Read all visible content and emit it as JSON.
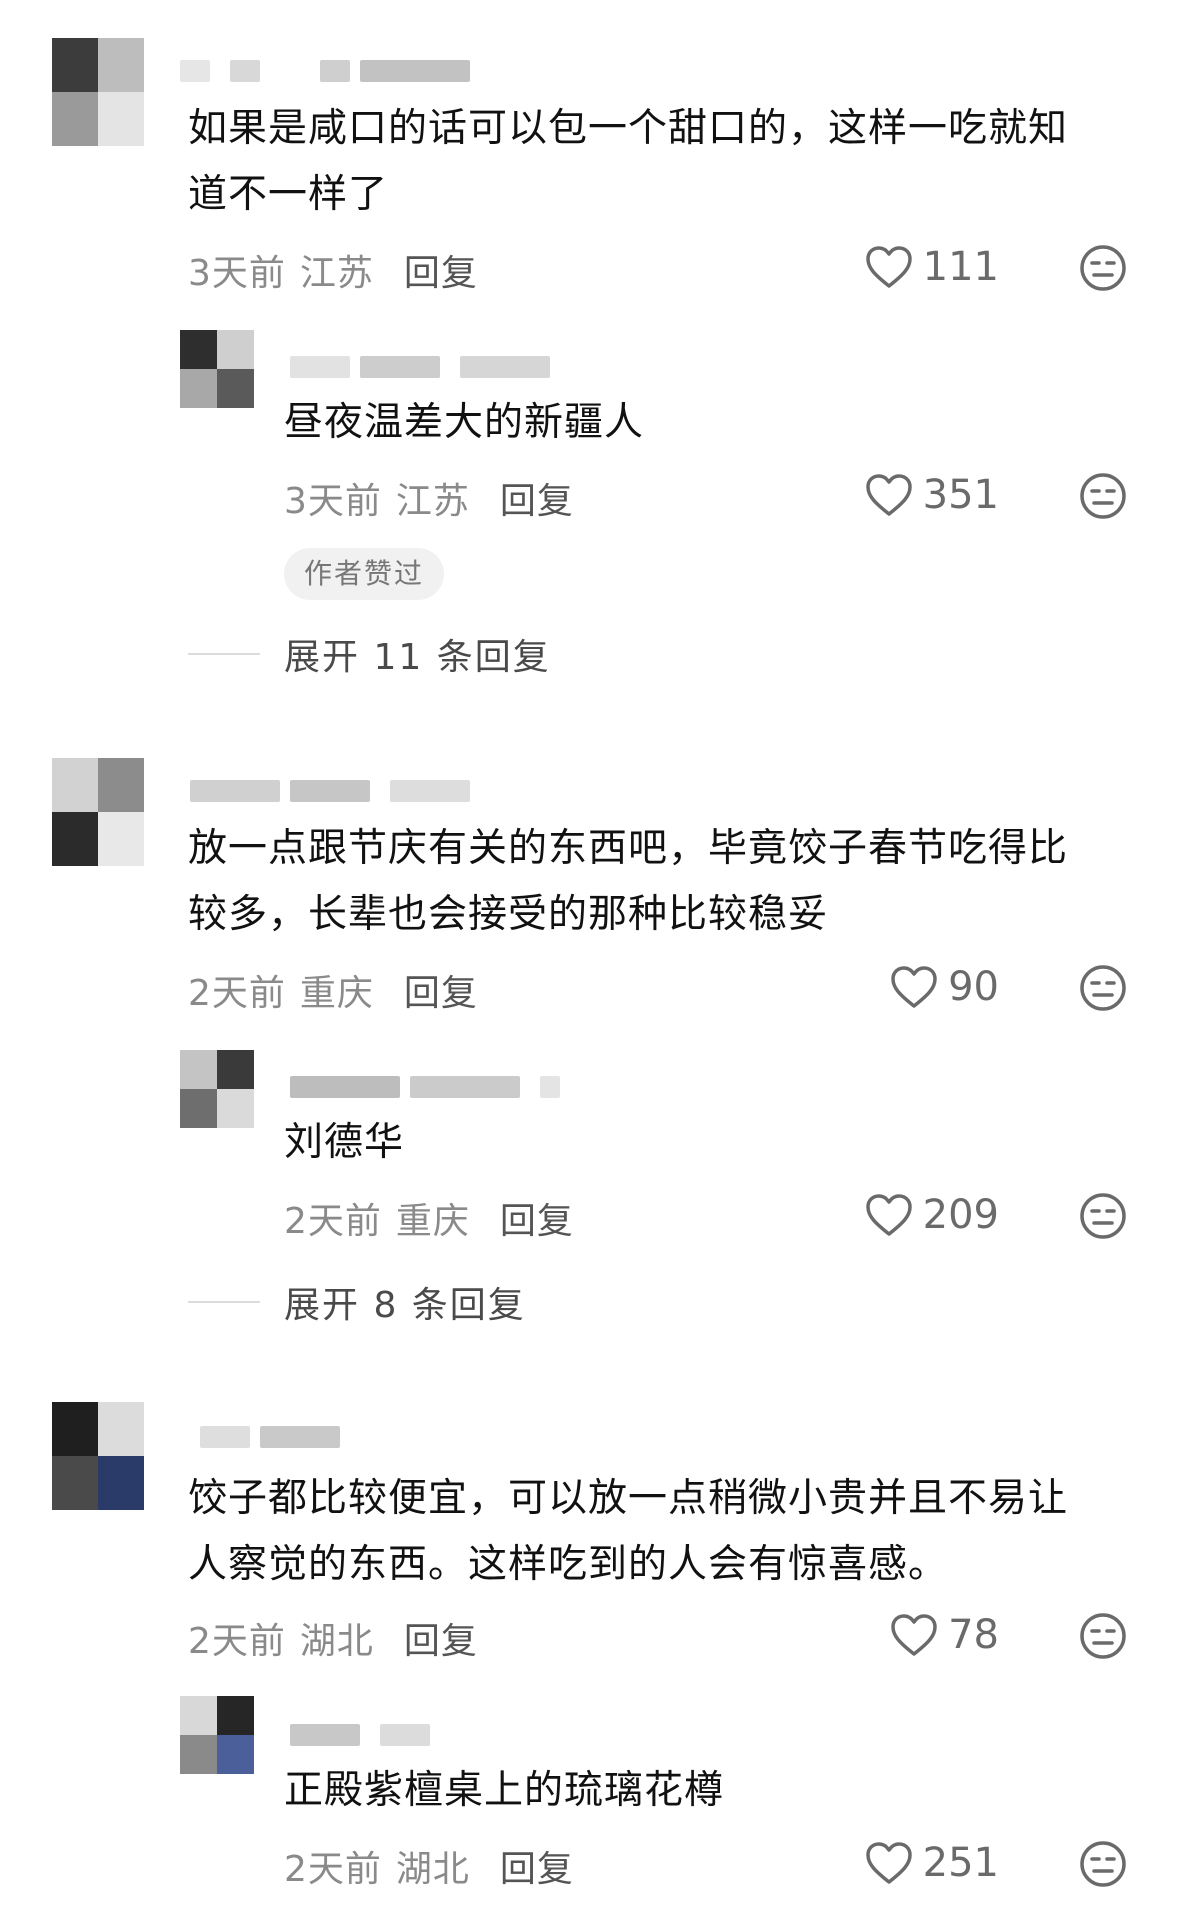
{
  "colors": {
    "text": "#111111",
    "meta": "#8a8a8a",
    "reply": "#555555",
    "icon": "#6a6a6a",
    "badge_bg": "#f1f1f1"
  },
  "icons": {
    "like": "heart-outline-icon",
    "dislike": "neutral-face-icon"
  },
  "comments": [
    {
      "text": "如果是咸口的话可以包一个甜口的，这样一吃就知\n道不一样了",
      "time": "3天前",
      "region": "江苏",
      "reply": "回复",
      "likes": "111",
      "subreply": {
        "text": "昼夜温差大的新疆人",
        "time": "3天前",
        "region": "江苏",
        "reply": "回复",
        "likes": "351",
        "badge": "作者赞过"
      },
      "expand": "展开 11 条回复"
    },
    {
      "text": "放一点跟节庆有关的东西吧，毕竟饺子春节吃得比\n较多，长辈也会接受的那种比较稳妥",
      "time": "2天前",
      "region": "重庆",
      "reply": "回复",
      "likes": "90",
      "subreply": {
        "text": "刘德华",
        "time": "2天前",
        "region": "重庆",
        "reply": "回复",
        "likes": "209"
      },
      "expand": "展开 8 条回复"
    },
    {
      "text": "饺子都比较便宜，可以放一点稍微小贵并且不易让\n人察觉的东西。这样吃到的人会有惊喜感。",
      "time": "2天前",
      "region": "湖北",
      "reply": "回复",
      "likes": "78",
      "subreply": {
        "text": "正殿紫檀桌上的琉璃花樽",
        "time": "2天前",
        "region": "湖北",
        "reply": "回复",
        "likes": "251"
      }
    }
  ]
}
